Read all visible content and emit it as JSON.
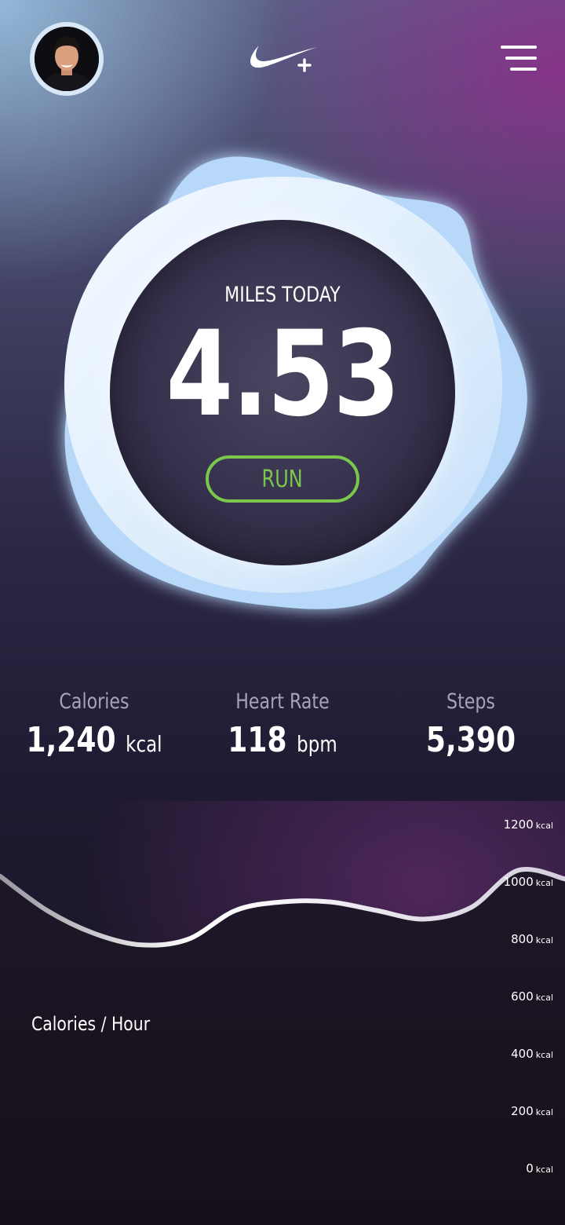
{
  "header": {
    "avatar_icon": "user-avatar-icon",
    "logo_icon": "swoosh-plus-logo-icon",
    "menu_icon": "menu-icon"
  },
  "hero": {
    "label": "MILES TODAY",
    "value": "4.53",
    "button_label": "RUN"
  },
  "stats": [
    {
      "label": "Calories",
      "value": "1,240",
      "unit": "kcal"
    },
    {
      "label": "Heart Rate",
      "value": "118",
      "unit": "bpm"
    },
    {
      "label": "Steps",
      "value": "5,390",
      "unit": ""
    }
  ],
  "chart_data": {
    "type": "line",
    "title": "Calories / Hour",
    "ylim": [
      0,
      1200
    ],
    "y_ticks": [
      {
        "value": "1200",
        "unit": "kcal"
      },
      {
        "value": "1000",
        "unit": "kcal"
      },
      {
        "value": "800",
        "unit": "kcal"
      },
      {
        "value": "600",
        "unit": "kcal"
      },
      {
        "value": "400",
        "unit": "kcal"
      },
      {
        "value": "200",
        "unit": "kcal"
      },
      {
        "value": "0",
        "unit": "kcal"
      }
    ],
    "x": [
      0,
      1,
      2,
      3,
      4,
      5,
      6,
      7,
      8,
      9,
      10,
      11,
      12
    ],
    "values": [
      1020,
      900,
      820,
      780,
      800,
      900,
      930,
      930,
      900,
      870,
      910,
      1040,
      1010
    ]
  },
  "colors": {
    "accent_green": "#7bc74d",
    "ring_light": "#d7e9fb",
    "blob_blue": "#b7d8f8"
  }
}
